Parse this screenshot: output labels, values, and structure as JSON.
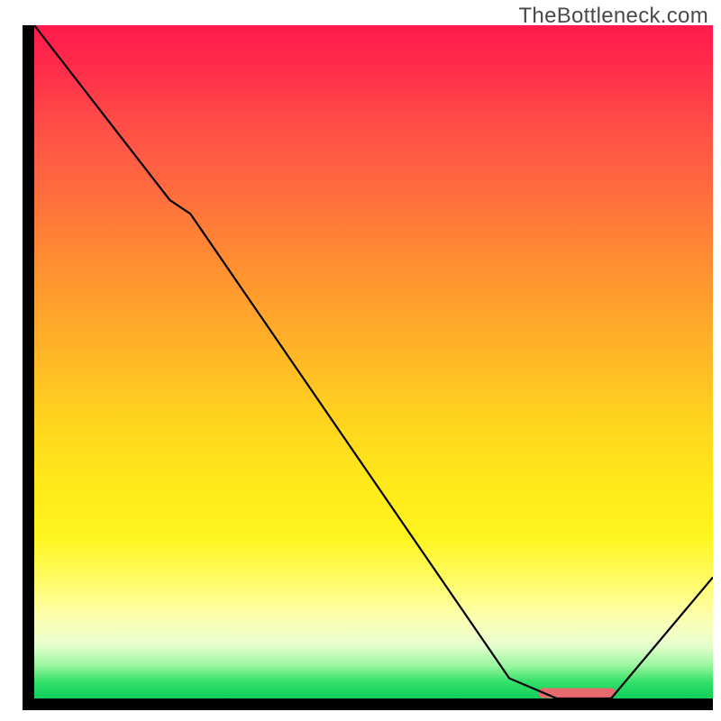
{
  "watermark": "TheBottleneck.com",
  "chart_data": {
    "type": "line",
    "title": "",
    "xlabel": "",
    "ylabel": "",
    "xlim": [
      0,
      100
    ],
    "ylim": [
      0,
      100
    ],
    "grid": false,
    "series": [
      {
        "name": "bottleneck-curve",
        "x": [
          0,
          20,
          23,
          70,
          77,
          85,
          100
        ],
        "y": [
          100,
          74,
          72,
          3,
          0,
          0,
          18
        ],
        "stroke": "#000000",
        "width": 2.2
      }
    ],
    "highlight_segment": {
      "name": "optimal-range-marker",
      "x_start": 75,
      "x_end": 85,
      "y": 0.8,
      "color": "#e86a6f",
      "thickness": 11,
      "cap": "round"
    },
    "background_gradient": {
      "direction": "vertical",
      "stops": [
        {
          "pos": 0.0,
          "color": "#ff1a4d"
        },
        {
          "pos": 0.34,
          "color": "#ff8a33"
        },
        {
          "pos": 0.68,
          "color": "#ffe91a"
        },
        {
          "pos": 0.9,
          "color": "#fdffb0"
        },
        {
          "pos": 1.0,
          "color": "#0ecf5a"
        }
      ]
    }
  }
}
